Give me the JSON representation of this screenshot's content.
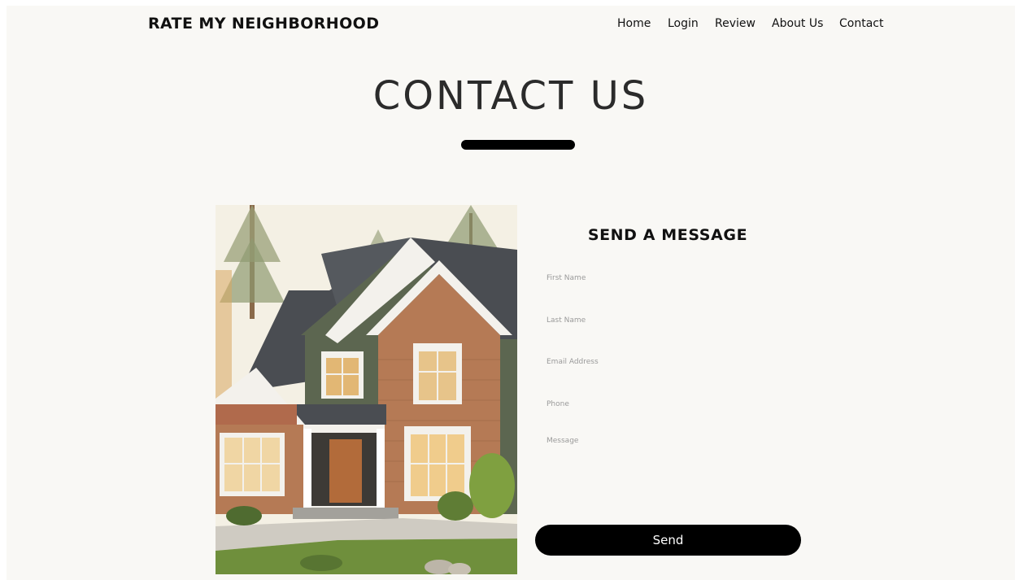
{
  "header": {
    "brand": "RATE MY NEIGHBORHOOD",
    "nav": [
      {
        "label": "Home"
      },
      {
        "label": "Login"
      },
      {
        "label": "Review"
      },
      {
        "label": "About Us"
      },
      {
        "label": "Contact"
      }
    ]
  },
  "hero": {
    "title": "CONTACT US"
  },
  "form": {
    "title": "SEND A MESSAGE",
    "fields": {
      "first_name": {
        "placeholder": "First Name",
        "value": ""
      },
      "last_name": {
        "placeholder": "Last Name",
        "value": ""
      },
      "email": {
        "placeholder": "Email Address",
        "value": ""
      },
      "phone": {
        "placeholder": "Phone",
        "value": ""
      },
      "message": {
        "placeholder": "Message",
        "value": ""
      }
    },
    "send_label": "Send"
  },
  "colors": {
    "page_bg": "#f9f8f5",
    "text": "#111111",
    "button_bg": "#000000",
    "button_text": "#ffffff",
    "placeholder": "#9a9a9a"
  }
}
